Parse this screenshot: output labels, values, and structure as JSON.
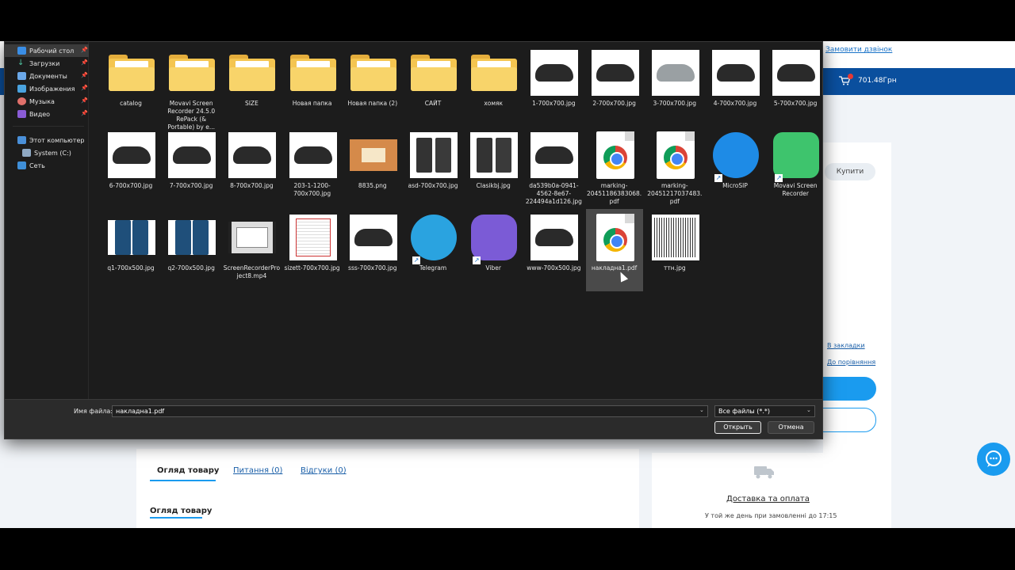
{
  "webpage": {
    "callback_link": "Замовити дзвінок",
    "cart_total": "701.48Грн",
    "cart_badge": "1",
    "buy_button": "Купити",
    "bookmark_link": "В закладки",
    "compare_link": "До порівняння",
    "tabs": [
      {
        "label": "Огляд товару"
      },
      {
        "label": "Питання (0)"
      },
      {
        "label": "Відгуки (0)"
      }
    ],
    "overview_heading": "Огляд товару",
    "delivery_title": "Доставка та оплата",
    "delivery_subtitle": "У той же день при замовленні до 17:15"
  },
  "dialog": {
    "nav": {
      "quick_access": [
        {
          "label": "Рабочий стол",
          "icon": "desktop-icon"
        },
        {
          "label": "Загрузки",
          "icon": "download-icon"
        },
        {
          "label": "Документы",
          "icon": "documents-icon"
        },
        {
          "label": "Изображения",
          "icon": "images-icon"
        },
        {
          "label": "Музыка",
          "icon": "music-icon"
        },
        {
          "label": "Видео",
          "icon": "video-icon"
        }
      ],
      "this_pc": "Этот компьютер",
      "system_drive": "System (C:)",
      "network": "Сеть"
    },
    "files": [
      {
        "name": "catalog",
        "kind": "folder"
      },
      {
        "name": "Movavi Screen Recorder 24.5.0 RePack (& Portable) by e...",
        "kind": "folder"
      },
      {
        "name": "SIZE",
        "kind": "folder"
      },
      {
        "name": "Новая папка",
        "kind": "folder"
      },
      {
        "name": "Новая папка (2)",
        "kind": "folder"
      },
      {
        "name": "САЙТ",
        "kind": "folder"
      },
      {
        "name": "хомяк",
        "kind": "folder"
      },
      {
        "name": "1-700x700.jpg",
        "kind": "shoe"
      },
      {
        "name": "2-700x700.jpg",
        "kind": "shoe"
      },
      {
        "name": "3-700x700.jpg",
        "kind": "shoe-grey"
      },
      {
        "name": "4-700x700.jpg",
        "kind": "shoe"
      },
      {
        "name": "5-700x700.jpg",
        "kind": "shoe"
      },
      {
        "name": "6-700x700.jpg",
        "kind": "shoe"
      },
      {
        "name": "7-700x700.jpg",
        "kind": "shoe"
      },
      {
        "name": "8-700x700.jpg",
        "kind": "shoe"
      },
      {
        "name": "203-1-1200-700x700.jpg",
        "kind": "shoe"
      },
      {
        "name": "8835.png",
        "kind": "poster"
      },
      {
        "name": "asd-700x700.jpg",
        "kind": "overalls"
      },
      {
        "name": "Clasikbj.jpg",
        "kind": "overalls"
      },
      {
        "name": "da539b0a-0941-4562-8e67-224494a1d126.jpg",
        "kind": "shoe"
      },
      {
        "name": "marking-20451186383068.pdf",
        "kind": "pdf"
      },
      {
        "name": "marking-20451217037483.pdf",
        "kind": "pdf"
      },
      {
        "name": "MicroSIP",
        "kind": "microsip"
      },
      {
        "name": "Movavi Screen Recorder",
        "kind": "movavi"
      },
      {
        "name": "q1-700x500.jpg",
        "kind": "pants"
      },
      {
        "name": "q2-700x500.jpg",
        "kind": "pants"
      },
      {
        "name": "ScreenRecorderProject8.mp4",
        "kind": "video"
      },
      {
        "name": "sizett-700x700.jpg",
        "kind": "sizechart"
      },
      {
        "name": "sss-700x700.jpg",
        "kind": "shoe"
      },
      {
        "name": "Telegram",
        "kind": "telegram"
      },
      {
        "name": "Viber",
        "kind": "viber"
      },
      {
        "name": "www-700x500.jpg",
        "kind": "shoe"
      },
      {
        "name": "накладна1.pdf",
        "kind": "pdf",
        "selected": true
      },
      {
        "name": "ттн.jpg",
        "kind": "barcode"
      }
    ],
    "filename_label": "Имя файла:",
    "filename_value": "накладна1.pdf",
    "filetype_value": "Все файлы (*.*)",
    "open_button": "Открыть",
    "cancel_button": "Отмена"
  },
  "colors": {
    "accent": "#1a9bef",
    "header_blue": "#0a4f9e",
    "dialog_bg": "#1c1c1c",
    "folder": "#f4c550"
  }
}
